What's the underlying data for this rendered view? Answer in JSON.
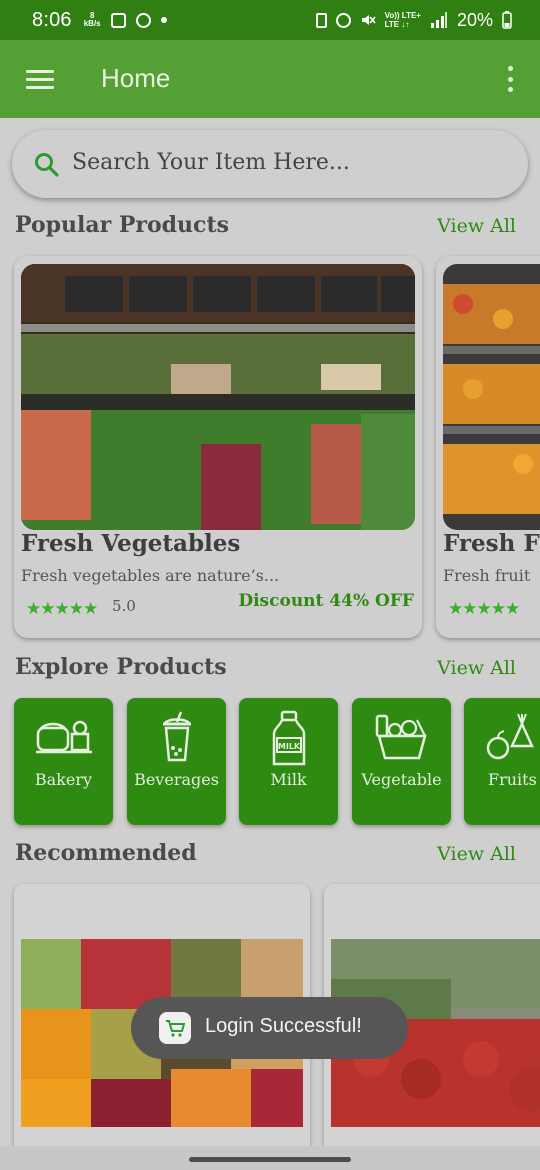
{
  "status_bar": {
    "time": "8:06",
    "net_speed_value": "8",
    "net_speed_unit": "kB/s",
    "volte_top": "Vo)) LTE+",
    "volte_bottom": "LTE ↓↑",
    "battery": "20%"
  },
  "app_bar": {
    "title": "Home",
    "menu_icon": "hamburger-menu-icon",
    "more_icon": "more-vert-icon"
  },
  "search": {
    "placeholder": "Search Your Item Here...",
    "icon": "search-icon"
  },
  "popular": {
    "title": "Popular Products",
    "view_all": "View All",
    "products": [
      {
        "name": "Fresh Vegetables",
        "description": "Fresh vegetables are nature’s...",
        "stars": "★★★★★",
        "rating": "5.0",
        "discount": "Discount 44% OFF"
      },
      {
        "name": "Fresh Fr",
        "description": "Fresh fruit",
        "stars": "★★★★★",
        "rating": "",
        "discount": ""
      }
    ]
  },
  "explore": {
    "title": "Explore Products",
    "view_all": "View All",
    "categories": [
      {
        "label": "Bakery",
        "icon": "bakery-icon"
      },
      {
        "label": "Beverages",
        "icon": "beverage-cup-icon"
      },
      {
        "label": "Milk",
        "icon": "milk-bottle-icon"
      },
      {
        "label": "Vegetable",
        "icon": "vegetable-basket-icon"
      },
      {
        "label": "Fruits",
        "icon": "fruits-icon"
      }
    ]
  },
  "recommended": {
    "title": "Recommended",
    "view_all": "View All"
  },
  "toast": {
    "message": "Login Successful!",
    "icon": "cart-icon"
  },
  "colors": {
    "status_bar": "#2f7f12",
    "app_bar": "#55a034",
    "accent_green": "#2f8a12",
    "star_green": "#3cad2c",
    "scrim_background": "#cfcfcf",
    "toast_background": "#565656"
  }
}
